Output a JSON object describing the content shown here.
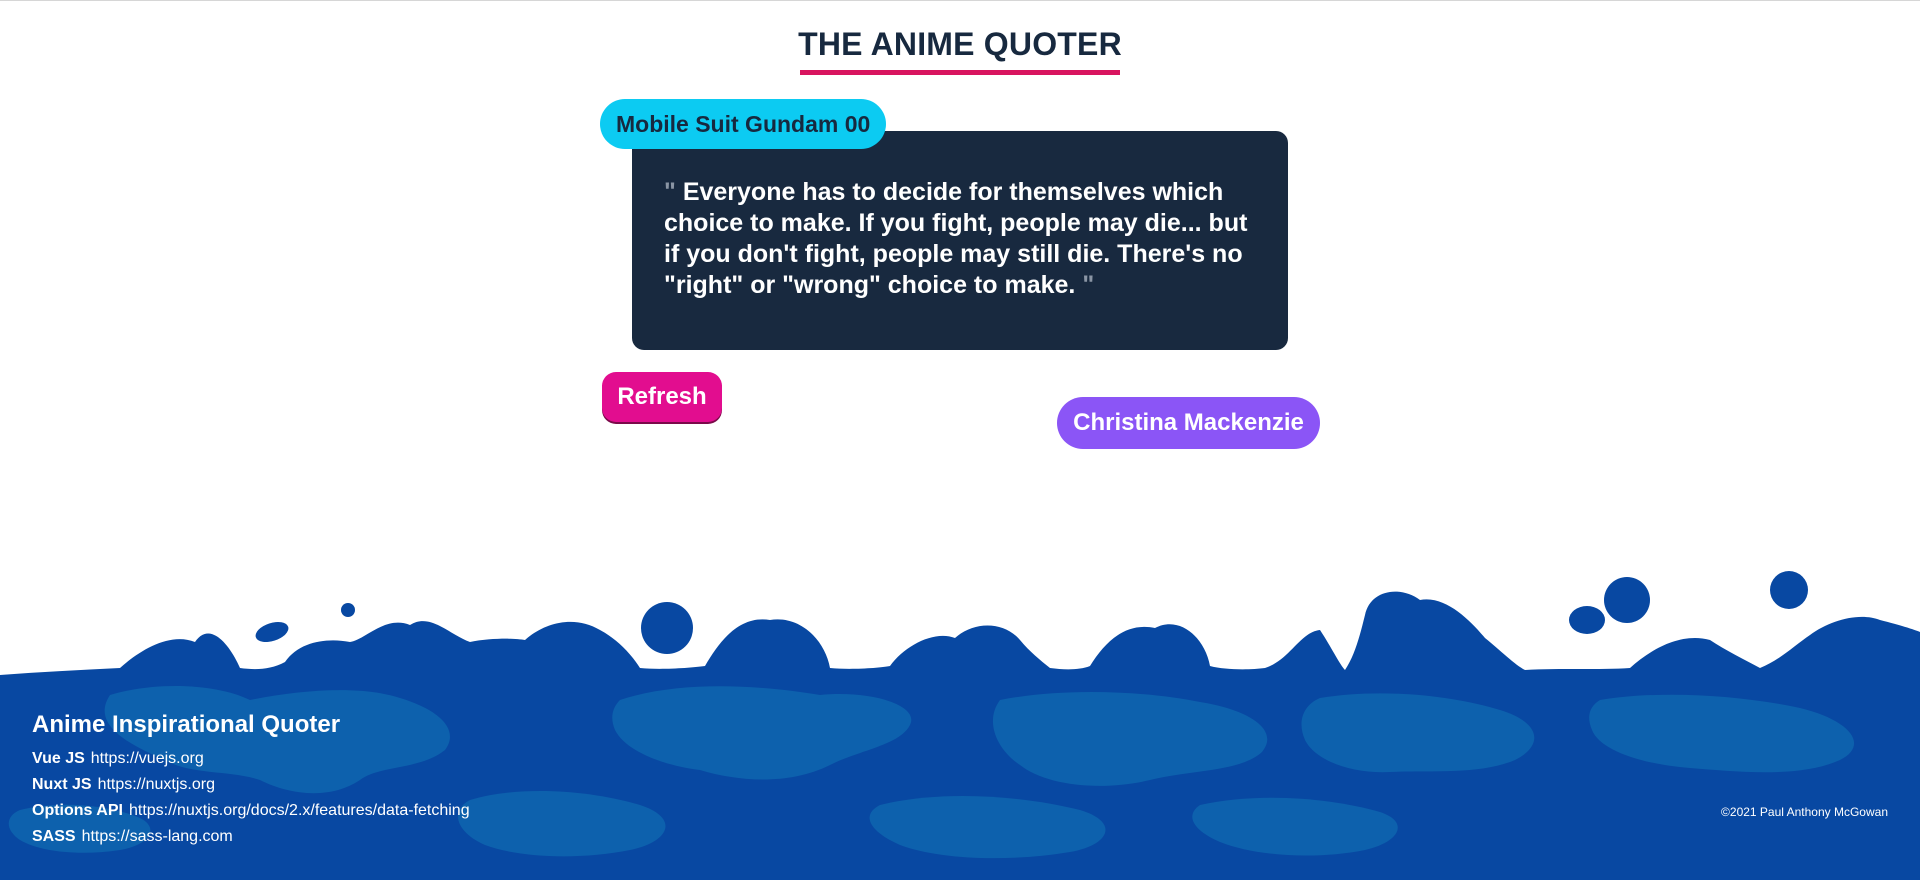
{
  "app": {
    "title": "THE ANIME QUOTER"
  },
  "quote": {
    "anime": "Mobile Suit Gundam 00",
    "text": "Everyone has to decide for themselves which choice to make. If you fight, people may die... but if you don't fight, people may still die. There's no \"right\" or \"wrong\" choice to make.",
    "open_mark": "\"",
    "close_mark": "\"",
    "character": "Christina Mackenzie"
  },
  "actions": {
    "refresh_label": "Refresh"
  },
  "footer": {
    "title": "Anime Inspirational Quoter",
    "tech": [
      {
        "name": "Vue JS",
        "url": "https://vuejs.org"
      },
      {
        "name": "Nuxt JS",
        "url": "https://nuxtjs.org"
      },
      {
        "name": "Options API",
        "url": "https://nuxtjs.org/docs/2.x/features/data-fetching"
      },
      {
        "name": "SASS",
        "url": "https://sass-lang.com"
      }
    ],
    "copyright": "©2021 Paul Anthony McGowan"
  },
  "colors": {
    "title_text": "#17293f",
    "title_underline": "#d8145f",
    "anime_badge": "#0ccbf2",
    "quote_card": "#18293f",
    "refresh_button": "#e20d8f",
    "character_badge": "#8b55f6",
    "footer_dark": "#0848a2",
    "footer_light": "#0d61ad"
  }
}
